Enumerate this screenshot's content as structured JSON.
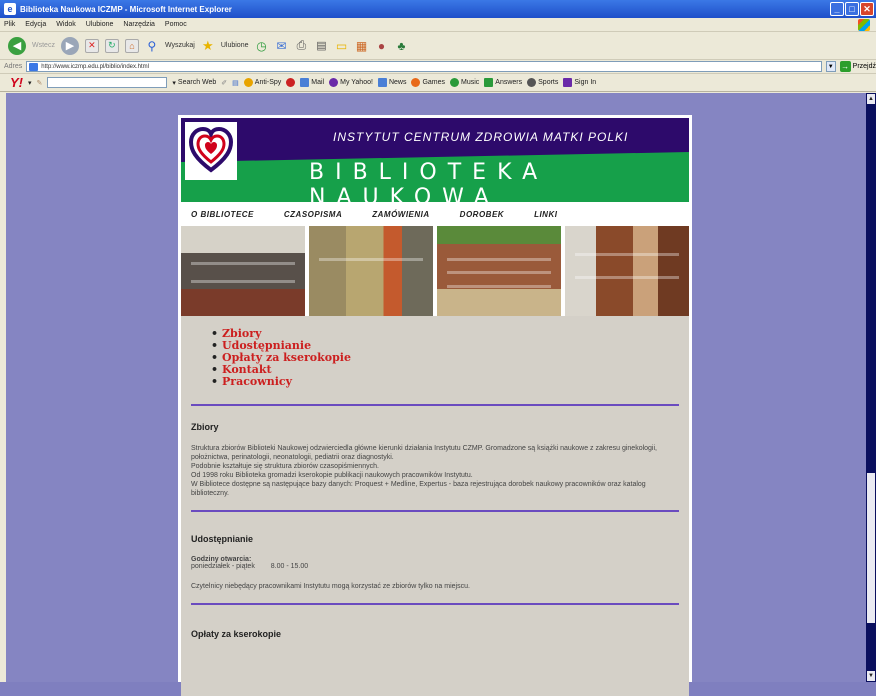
{
  "window": {
    "title": "Biblioteka Naukowa ICZMP - Microsoft Internet Explorer"
  },
  "menu": [
    "Plik",
    "Edycja",
    "Widok",
    "Ulubione",
    "Narzędzia",
    "Pomoc"
  ],
  "toolbar": {
    "back_label": "Wstecz",
    "search_label": "Wyszukaj",
    "favorites_label": "Ulubione"
  },
  "address": {
    "label": "Adres",
    "url": "http://www.iczmp.edu.pl/biblio/index.html",
    "go_label": "Przejdź"
  },
  "yahoo": {
    "search_web": "Search Web",
    "items": [
      "Anti-Spy",
      "Mail",
      "My Yahoo!",
      "News",
      "Games",
      "Music",
      "Answers",
      "Sports",
      "Sign In"
    ]
  },
  "banner": {
    "institute": "INSTYTUT CENTRUM ZDROWIA MATKI POLKI",
    "library": "BIBLIOTEKA NAUKOWA"
  },
  "nav": [
    "O BIBLIOTECE",
    "CZASOPISMA",
    "ZAMÓWIENIA",
    "DOROBEK",
    "LINKI"
  ],
  "links": [
    "Zbiory",
    "Udostępnianie",
    "Opłaty za kserokopie",
    "Kontakt",
    "Pracownicy"
  ],
  "sections": {
    "zbiory": {
      "title": "Zbiory",
      "text": "Struktura zbiorów Biblioteki Naukowej odzwierciedla główne kierunki działania Instytutu CZMP. Gromadzone są książki naukowe z zakresu ginekologii, położnictwa, perinatologii, neonatologii, pediatrii oraz diagnostyki.\nPodobnie kształtuje się struktura zbiorów czasopiśmiennych.\nOd 1998 roku Biblioteka gromadzi kserokopie publikacji naukowych pracowników Instytutu.\nW Bibliotece dostępne są następujące bazy danych: Proquest + Medline, Expertus - baza rejestrująca dorobek naukowy pracowników oraz katalog biblioteczny."
    },
    "udostepnianie": {
      "title": "Udostępnianie",
      "hours_label": "Godziny otwarcia:",
      "days": "poniedziałek - piątek",
      "hours": "8.00 - 15.00",
      "text": "Czytelnicy niebędący pracownikami Instytutu mogą korzystać ze zbiorów tylko na miejscu."
    },
    "oplaty": {
      "title": "Opłaty za kserokopie"
    }
  }
}
